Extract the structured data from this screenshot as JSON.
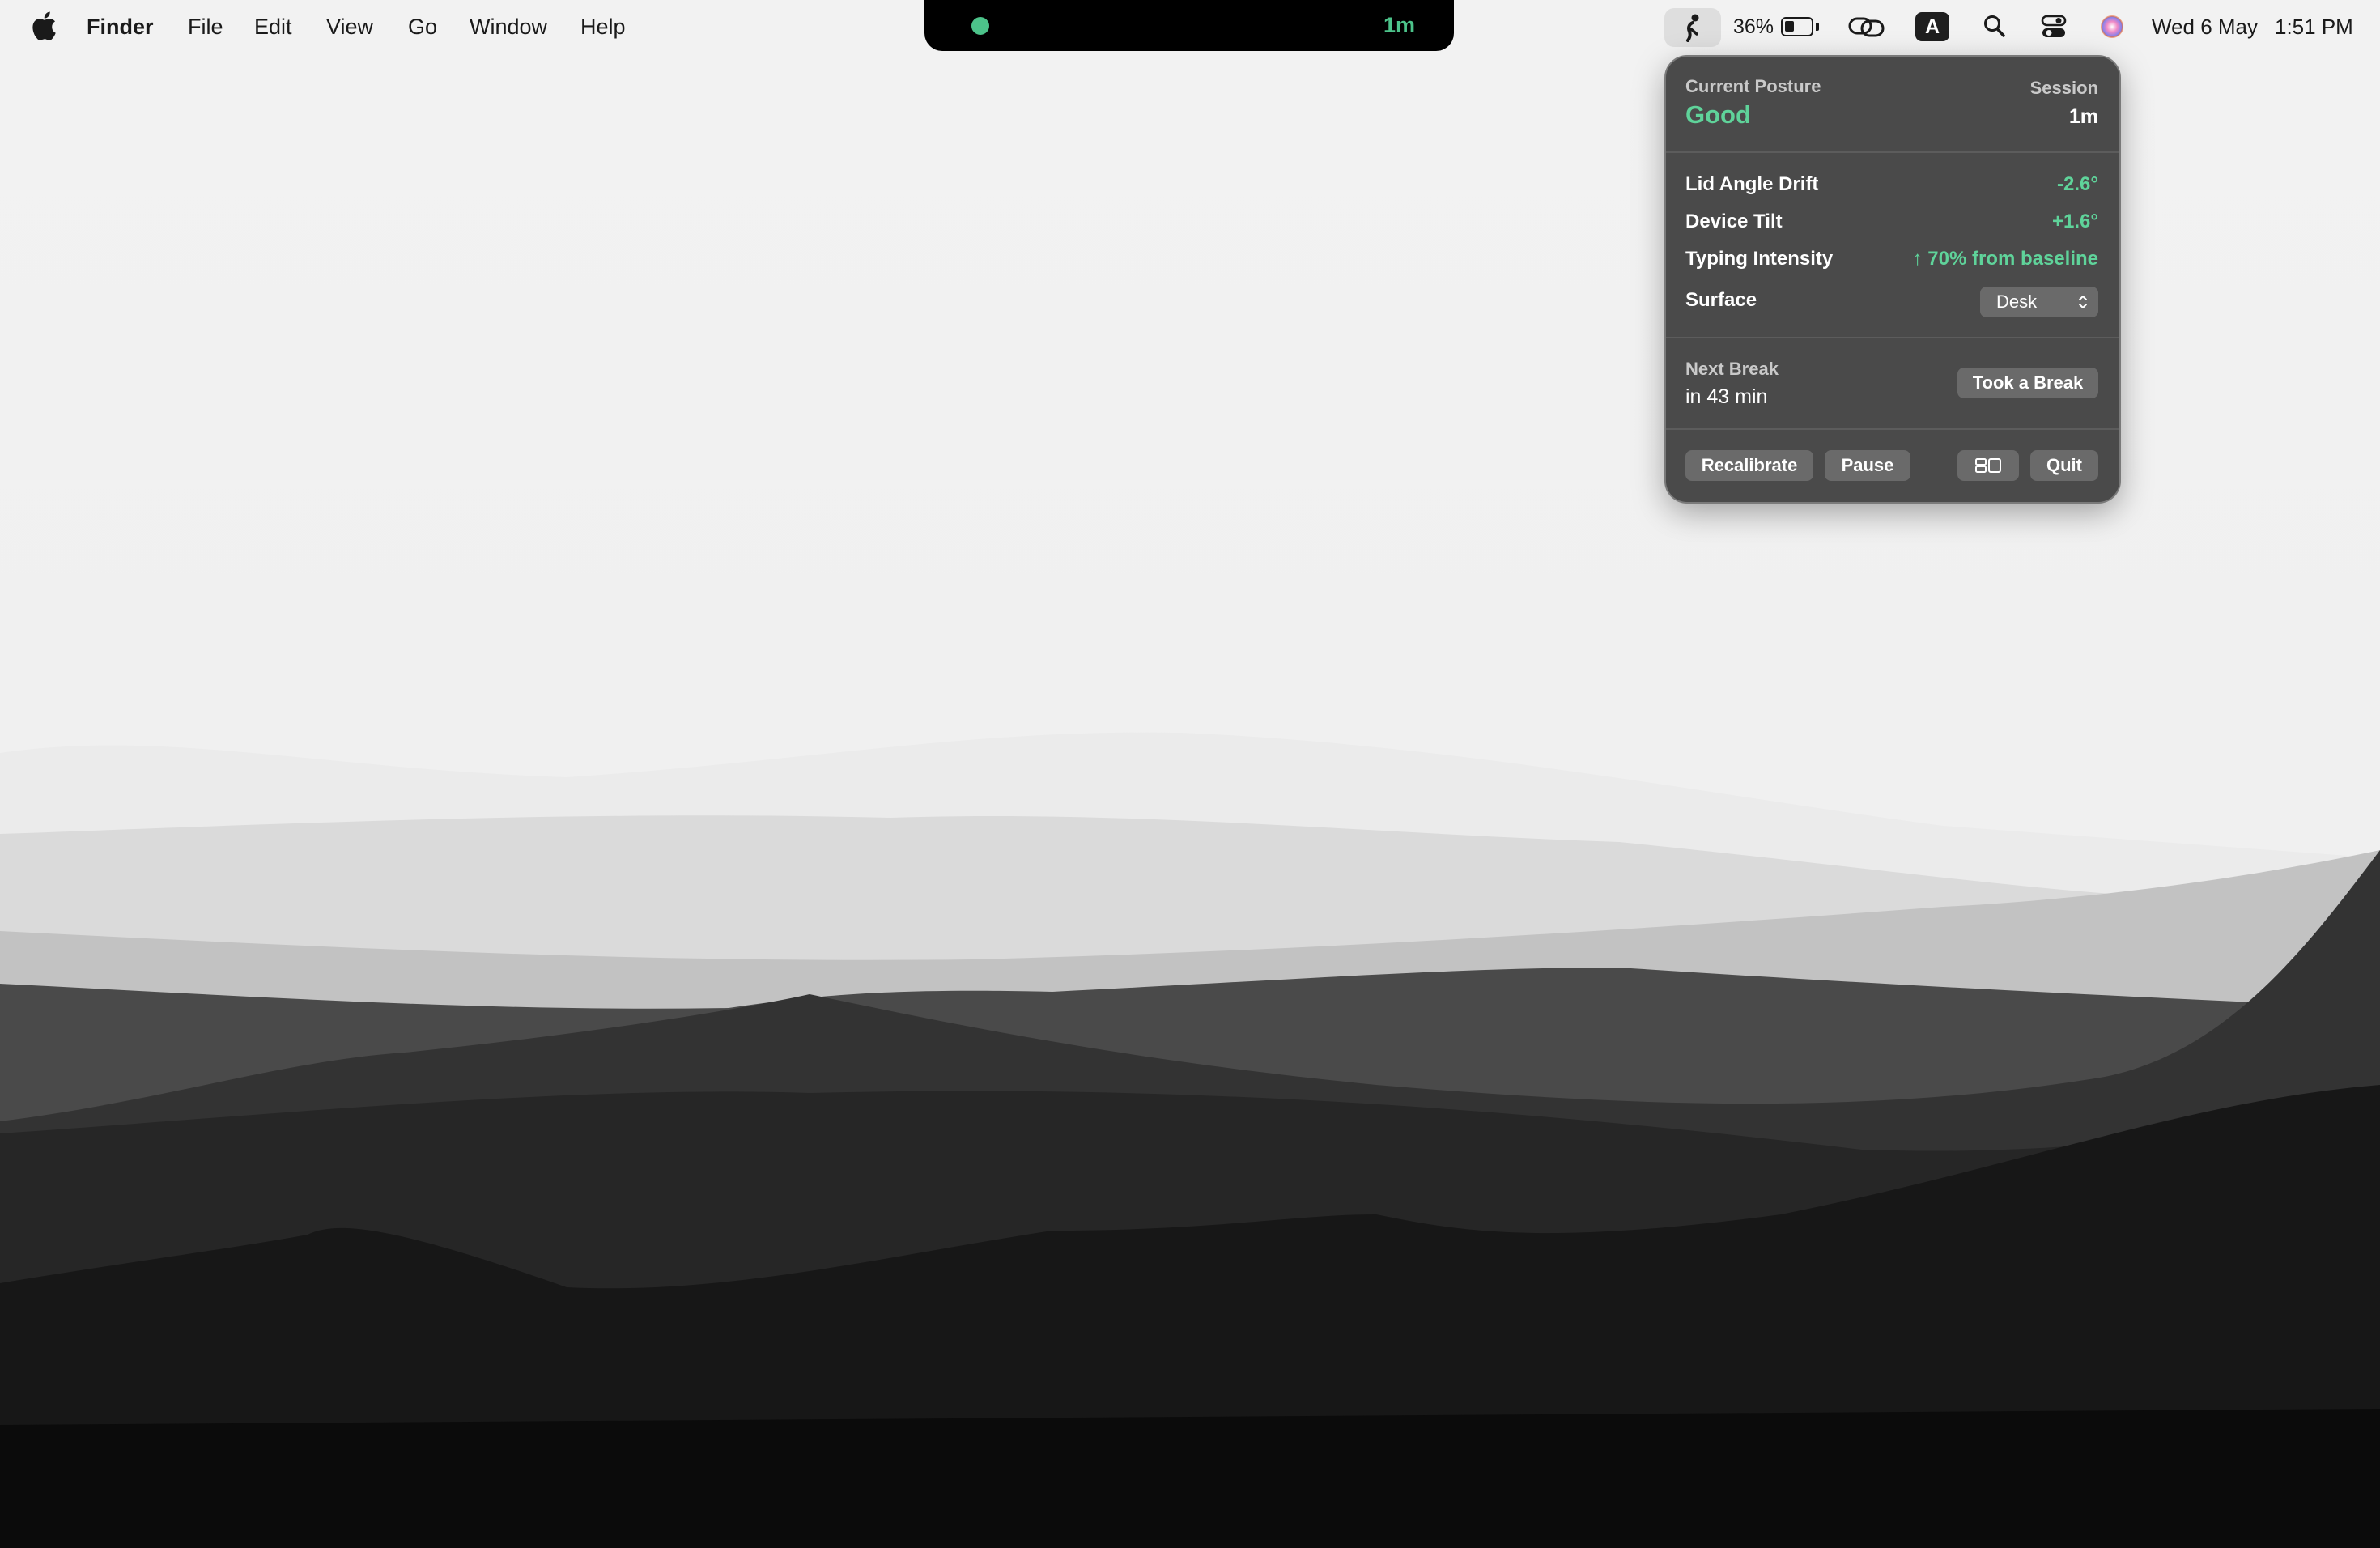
{
  "menubar": {
    "app_name": "Finder",
    "menus": [
      "File",
      "Edit",
      "View",
      "Go",
      "Window",
      "Help"
    ],
    "island": {
      "status_color": "#4cc38a",
      "session_time": "1m"
    },
    "status": {
      "battery_percent": "36%",
      "battery_level": 0.36,
      "input_source": "A",
      "icons": [
        "posture-app-icon",
        "battery-icon",
        "link-icon",
        "input-source-icon",
        "search-icon",
        "control-center-icon",
        "siri-icon"
      ],
      "date": "Wed 6 May",
      "time": "1:51 PM"
    }
  },
  "popover": {
    "current_posture_label": "Current Posture",
    "current_posture_value": "Good",
    "session_label": "Session",
    "session_value": "1m",
    "metrics": [
      {
        "label": "Lid Angle Drift",
        "value": "-2.6°"
      },
      {
        "label": "Device Tilt",
        "value": "+1.6°"
      },
      {
        "label": "Typing Intensity",
        "value": "↑ 70% from baseline"
      }
    ],
    "surface_label": "Surface",
    "surface_value": "Desk",
    "next_break_label": "Next Break",
    "next_break_value": "in 43 min",
    "took_break_button": "Took a Break",
    "recalibrate_button": "Recalibrate",
    "pause_button": "Pause",
    "quit_button": "Quit",
    "accent_color": "#5fd39a"
  }
}
